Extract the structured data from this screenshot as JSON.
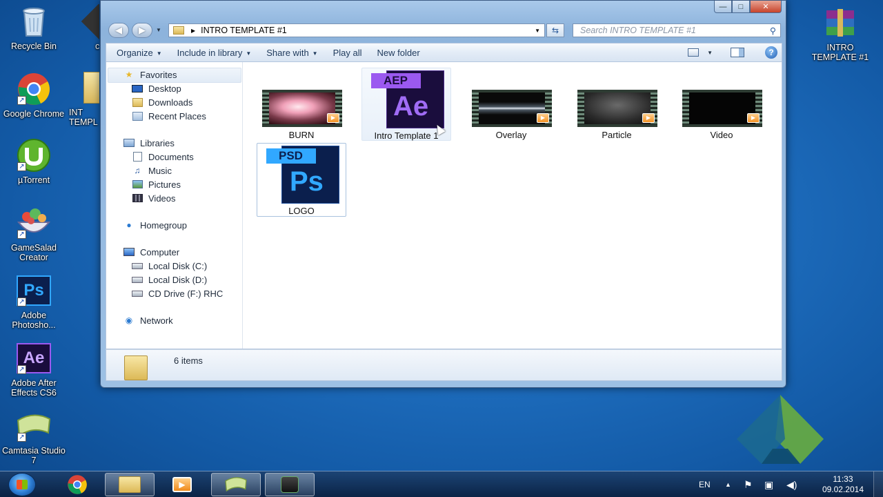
{
  "desktop": {
    "icons": [
      {
        "label": "Recycle Bin"
      },
      {
        "label": "Google Chrome"
      },
      {
        "label": "µTorrent"
      },
      {
        "label": "GameSalad Creator"
      },
      {
        "label": "Adobe Photosho..."
      },
      {
        "label": "Adobe After Effects CS6"
      },
      {
        "label": "Camtasia Studio 7"
      },
      {
        "label": "INTRO TEMPLATE #1"
      }
    ],
    "partial_label_1": "c",
    "partial_label_2": "INT TEMPL",
    "ps_badge": "Ps",
    "ae_badge": "Ae"
  },
  "window": {
    "address_path": "INTRO TEMPLATE #1",
    "search_placeholder": "Search INTRO TEMPLATE #1",
    "controls": {
      "minimize": "—",
      "maximize": "□",
      "close": "✕"
    }
  },
  "toolbar": {
    "organize": "Organize",
    "include_in_library": "Include in library",
    "share_with": "Share with",
    "play_all": "Play all",
    "new_folder": "New folder"
  },
  "nav": {
    "favorites": "Favorites",
    "desktop": "Desktop",
    "downloads": "Downloads",
    "recent_places": "Recent Places",
    "libraries": "Libraries",
    "documents": "Documents",
    "music": "Music",
    "pictures": "Pictures",
    "videos": "Videos",
    "homegroup": "Homegroup",
    "computer": "Computer",
    "local_c": "Local Disk (C:)",
    "local_d": "Local Disk (D:)",
    "cd_drive": "CD Drive (F:) RHC",
    "network": "Network"
  },
  "files": [
    {
      "name": "BURN",
      "type": "video"
    },
    {
      "name": "Intro Template 1",
      "type": "aep",
      "badge": "AEP",
      "logo": "Ae"
    },
    {
      "name": "Overlay",
      "type": "video"
    },
    {
      "name": "Particle",
      "type": "video"
    },
    {
      "name": "Video",
      "type": "video"
    },
    {
      "name": "LOGO",
      "type": "psd",
      "badge": "PSD",
      "logo": "Ps"
    }
  ],
  "status": {
    "item_count": "6 items"
  },
  "taskbar": {
    "language": "EN",
    "time": "11:33",
    "date": "09.02.2014"
  },
  "colors": {
    "ae_purple": "#9b59f0",
    "ae_dark": "#1a0d3d",
    "ps_blue": "#31a8ff",
    "ps_dark": "#0b1f4d",
    "accent": "#1e395b"
  }
}
